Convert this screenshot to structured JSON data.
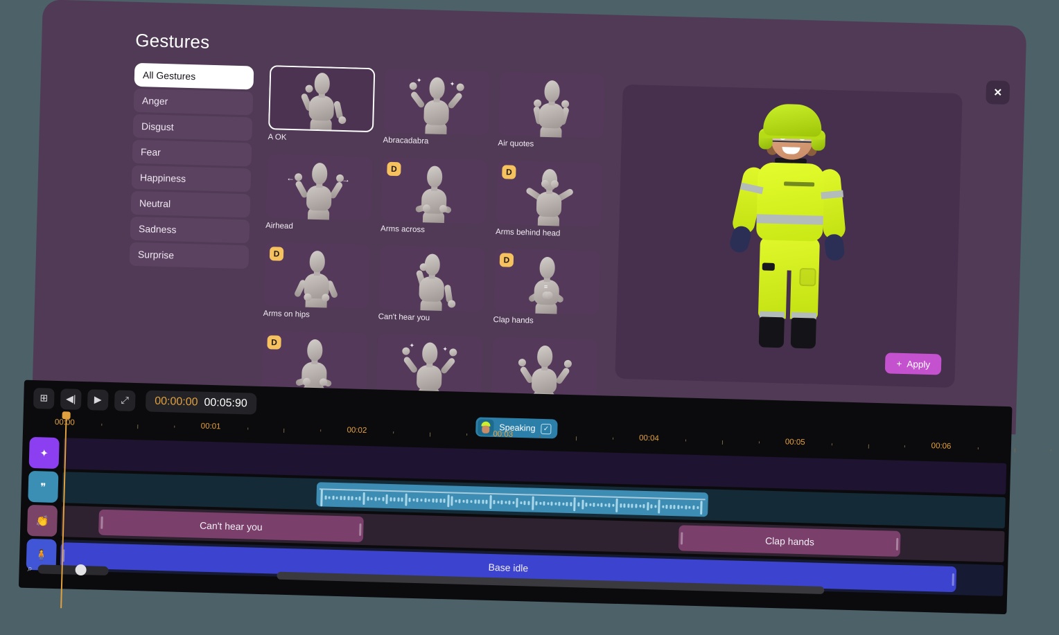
{
  "modal": {
    "title": "Gestures",
    "close_icon": "close-icon",
    "close_label": "✕"
  },
  "categories": [
    {
      "label": "All Gestures",
      "active": true
    },
    {
      "label": "Anger",
      "active": false
    },
    {
      "label": "Disgust",
      "active": false
    },
    {
      "label": "Fear",
      "active": false
    },
    {
      "label": "Happiness",
      "active": false
    },
    {
      "label": "Neutral",
      "active": false
    },
    {
      "label": "Sadness",
      "active": false
    },
    {
      "label": "Surprise",
      "active": false
    }
  ],
  "gestures": [
    {
      "label": "A OK",
      "badge": "",
      "selected": true,
      "pose": "aok"
    },
    {
      "label": "Abracadabra",
      "badge": "",
      "selected": false,
      "pose": "both-up"
    },
    {
      "label": "Air quotes",
      "badge": "",
      "selected": false,
      "pose": "quotes"
    },
    {
      "label": "Airhead",
      "badge": "",
      "selected": false,
      "pose": "airhead"
    },
    {
      "label": "Arms across",
      "badge": "D",
      "selected": false,
      "pose": "crossed"
    },
    {
      "label": "Arms behind head",
      "badge": "D",
      "selected": false,
      "pose": "behind-head"
    },
    {
      "label": "Arms on hips",
      "badge": "D",
      "selected": false,
      "pose": "hips"
    },
    {
      "label": "Can't hear you",
      "badge": "",
      "selected": false,
      "pose": "hear"
    },
    {
      "label": "Clap hands",
      "badge": "D",
      "selected": false,
      "pose": "clap"
    },
    {
      "label": "",
      "badge": "D",
      "selected": false,
      "pose": "crossed"
    },
    {
      "label": "",
      "badge": "",
      "selected": false,
      "pose": "both-up"
    },
    {
      "label": "",
      "badge": "",
      "selected": false,
      "pose": "point"
    }
  ],
  "preview": {
    "apply_label": "Apply",
    "apply_icon": "plus-icon",
    "avatar_name": "avatar-construction-worker"
  },
  "timeline": {
    "tools": [
      {
        "name": "add-clip-button",
        "glyph": "⊞"
      },
      {
        "name": "skip-to-start-button",
        "glyph": "◀|"
      },
      {
        "name": "play-button",
        "glyph": "▶"
      },
      {
        "name": "expand-button",
        "glyph": "⤢"
      }
    ],
    "timecode_current": "00:00:00",
    "timecode_total": "00:05:90",
    "speaking": {
      "label": "Speaking",
      "checked": true,
      "check_glyph": "✓"
    },
    "ruler_labels": [
      "00:00",
      "00:01",
      "00:02",
      "00:03",
      "00:04",
      "00:05",
      "00:06"
    ],
    "tracks": [
      {
        "name": "effects-track",
        "icon": "sparkle-icon",
        "icon_glyph": "✦",
        "icon_color": "#8b3ff0",
        "lane_color": "#1e1330",
        "clips": []
      },
      {
        "name": "speech-track",
        "icon": "speech-bubble-icon",
        "icon_glyph": "❞",
        "icon_color": "#3b8fb5",
        "lane_color": "#142a36",
        "clips": [
          {
            "label": "",
            "type": "waveform",
            "left_pct": 27.0,
            "width_pct": 41.5,
            "color": "#3d8cb3"
          }
        ]
      },
      {
        "name": "gesture-track",
        "icon": "clap-hands-icon",
        "icon_glyph": "👏",
        "icon_color": "#7a4468",
        "lane_color": "#2e2130",
        "clips": [
          {
            "label": "Can't hear you",
            "type": "clip",
            "left_pct": 4.0,
            "width_pct": 28.0,
            "color": "#7a3f6b"
          },
          {
            "label": "Clap hands",
            "type": "clip",
            "left_pct": 65.5,
            "width_pct": 23.5,
            "color": "#7a3f6b"
          }
        ]
      },
      {
        "name": "body-track",
        "icon": "person-icon",
        "icon_glyph": "🧍",
        "icon_color": "#4156d6",
        "lane_color": "#161a33",
        "clips": [
          {
            "label": "Base idle",
            "type": "clip",
            "left_pct": 0.0,
            "width_pct": 95.0,
            "color": "#3c43cf"
          }
        ]
      }
    ],
    "zoom_icon": "magnifier-icon",
    "zoom_glyph": "⌕"
  },
  "colors": {
    "page_bg": "#4d6168",
    "modal_bg": "#503a55",
    "preview_bg": "#46304d",
    "card_bg": "#54395a",
    "accent_apply": "#c452ce",
    "accent_timecode": "#e2a03f",
    "badge_bg": "#f5c25f",
    "timeline_bg": "#0b0b0d"
  }
}
